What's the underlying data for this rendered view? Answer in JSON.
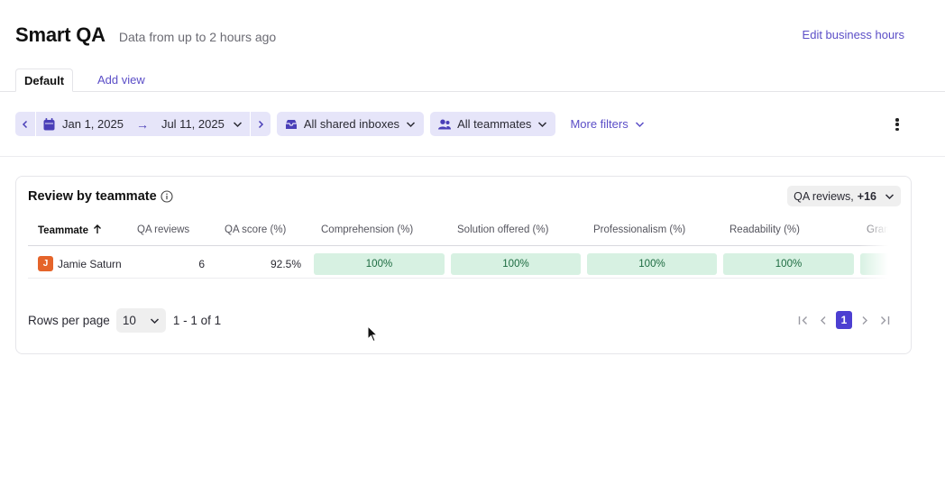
{
  "header": {
    "title": "Smart QA",
    "data_note": "Data from up to 2 hours ago",
    "edit_link": "Edit business hours"
  },
  "tabs": [
    {
      "label": "Default",
      "active": true
    },
    {
      "label": "Add view",
      "active": false
    }
  ],
  "filters": {
    "start_date": "Jan 1, 2025",
    "end_date": "Jul 11, 2025",
    "inboxes": "All shared inboxes",
    "teammates": "All teammates",
    "more_filters": "More filters"
  },
  "card": {
    "title": "Review by teammate",
    "metric_select": {
      "value": "QA reviews,",
      "extra": "+16"
    },
    "columns": [
      "Teammate",
      "QA reviews",
      "QA score (%)",
      "Comprehension (%)",
      "Solution offered (%)",
      "Professionalism (%)",
      "Readability (%)",
      "Gramm"
    ],
    "rows": [
      {
        "initial": "J",
        "teammate": "Jamie Saturn",
        "qa_reviews": "6",
        "qa_score": "92.5%",
        "comprehension": "100%",
        "solution_offered": "100%",
        "professionalism": "100%",
        "readability": "100%"
      }
    ],
    "pagination": {
      "rows_per_page_label": "Rows per page",
      "rows_per_page": "10",
      "range": "1 - 1 of 1",
      "current_page": "1"
    }
  },
  "colors": {
    "accent": "#5b4ec7",
    "pill_bg": "#e6e5f9",
    "score_bg": "#d7f1e2",
    "score_text": "#1d6b41",
    "avatar": "#e5642a",
    "page_active": "#4c3fd1"
  }
}
